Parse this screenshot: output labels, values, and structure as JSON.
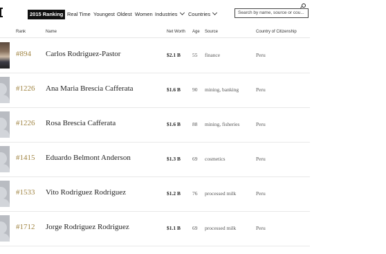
{
  "nav": {
    "active_tab": "2015 Ranking",
    "items": [
      "Real Time",
      "Youngest",
      "Oldest",
      "Women",
      "Industries",
      "Countries"
    ],
    "search_placeholder": "Search by name, source or cou..."
  },
  "table": {
    "headers": {
      "rank": "Rank",
      "name": "Name",
      "net_worth": "Net Worth",
      "age": "Age",
      "source": "Source",
      "country": "Country of Citizenship"
    },
    "rows": [
      {
        "rank": "#894",
        "name": "Carlos Rodriguez-Pastor",
        "net_worth": "$2.1 B",
        "age": "55",
        "source": "finance",
        "country": "Peru"
      },
      {
        "rank": "#1226",
        "name": "Ana Maria Brescia Cafferata",
        "net_worth": "$1.6 B",
        "age": "90",
        "source": "mining, banking",
        "country": "Peru"
      },
      {
        "rank": "#1226",
        "name": "Rosa Brescia Cafferata",
        "net_worth": "$1.6 B",
        "age": "88",
        "source": "mining, fisheries",
        "country": "Peru"
      },
      {
        "rank": "#1415",
        "name": "Eduardo Belmont Anderson",
        "net_worth": "$1.3 B",
        "age": "69",
        "source": "cosmetics",
        "country": "Peru"
      },
      {
        "rank": "#1533",
        "name": "Vito Rodriguez Rodriguez",
        "net_worth": "$1.2 B",
        "age": "76",
        "source": "processed milk",
        "country": "Peru"
      },
      {
        "rank": "#1712",
        "name": "Jorge Rodriguez Rodriguez",
        "net_worth": "$1.1 B",
        "age": "69",
        "source": "processed milk",
        "country": "Peru"
      }
    ]
  },
  "colors": {
    "rank": "#a08442",
    "active_tab_bg": "#111111"
  }
}
